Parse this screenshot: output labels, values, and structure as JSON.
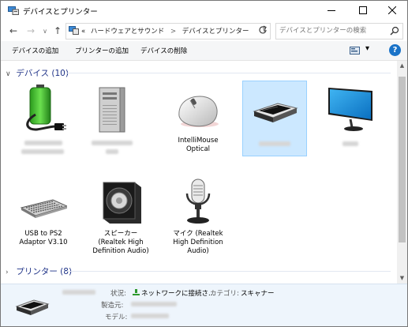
{
  "window": {
    "title": "デバイスとプリンター",
    "controls": {
      "minimize": "—",
      "maximize": "☐",
      "close": "✕"
    }
  },
  "nav": {
    "back": "←",
    "forward": "→",
    "up": "↑",
    "breadcrumb": [
      "ハードウェアとサウンド",
      "デバイスとプリンター"
    ],
    "overflow": "«",
    "separator": ">",
    "dropdown": "∨",
    "refresh": "↻"
  },
  "search": {
    "placeholder": "デバイスとプリンターの検索"
  },
  "commands": {
    "add_device": "デバイスの追加",
    "add_printer": "プリンターの追加",
    "remove_device": "デバイスの削除",
    "view_dropdown": "▾",
    "help": "?"
  },
  "groups": {
    "devices": {
      "label": "デバイス (10)",
      "chevron": "∨"
    },
    "printers": {
      "label": "プリンター (8)",
      "chevron": "›"
    }
  },
  "devices": [
    {
      "name": "",
      "icon": "battery-ups-icon",
      "blurred": true
    },
    {
      "name": "",
      "icon": "computer-tower-icon",
      "blurred": true
    },
    {
      "name": "IntelliMouse Optical",
      "icon": "mouse-icon",
      "blurred": false
    },
    {
      "name": "",
      "icon": "scanner-icon",
      "blurred": true,
      "selected": true
    },
    {
      "name": "",
      "icon": "monitor-icon",
      "blurred": true
    },
    {
      "name": "USB to PS2 Adaptor  V3.10",
      "icon": "keyboard-icon",
      "blurred": false
    },
    {
      "name": "スピーカー (Realtek High Definition Audio)",
      "icon": "speaker-icon",
      "blurred": false
    },
    {
      "name": "マイク (Realtek High Definition Audio)",
      "icon": "microphone-icon",
      "blurred": false
    }
  ],
  "details": {
    "status_key": "状況:",
    "status_value": "ネットワークに接続さ...",
    "category_key": "カテゴリ:",
    "category_value": "スキャナー",
    "manufacturer_key": "製造元:",
    "model_key": "モデル:"
  },
  "colors": {
    "accent": "#1e3287",
    "selection": "#cce8ff",
    "help": "#1a73c8",
    "details_bg": "#eef5fc"
  }
}
